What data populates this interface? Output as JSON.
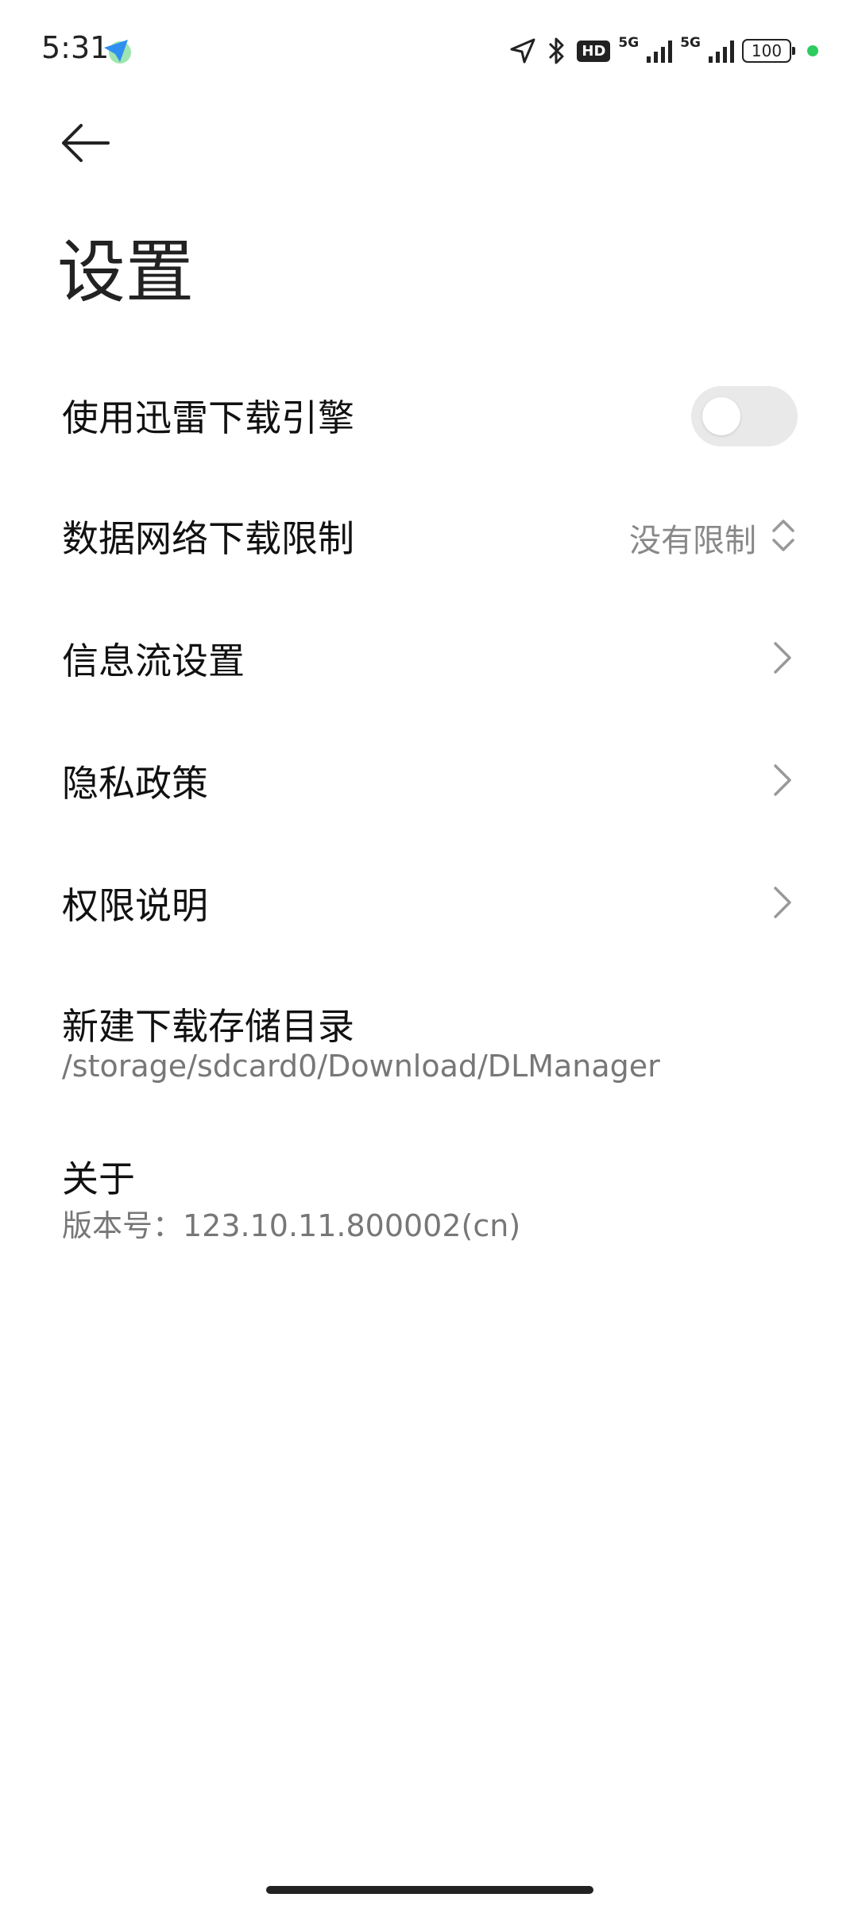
{
  "status_bar": {
    "time": "5:31",
    "hd_label": "HD",
    "network1": "5G",
    "network2": "5G",
    "battery": "100"
  },
  "header": {
    "title": "设置"
  },
  "settings": {
    "thunder_engine": {
      "label": "使用迅雷下载引擎",
      "enabled": false
    },
    "data_limit": {
      "label": "数据网络下载限制",
      "value": "没有限制"
    },
    "feed": {
      "label": "信息流设置"
    },
    "privacy": {
      "label": "隐私政策"
    },
    "permissions": {
      "label": "权限说明"
    },
    "storage": {
      "label": "新建下载存储目录",
      "path": "/storage/sdcard0/Download/DLManager"
    },
    "about": {
      "label": "关于",
      "version": "版本号：123.10.11.800002(cn)"
    }
  },
  "icons": {
    "back": "arrow-left-icon",
    "chevron": "chevron-right-icon",
    "updown": "chevron-up-down-icon",
    "location": "location-icon",
    "bluetooth": "bluetooth-icon"
  },
  "colors": {
    "accent_dot": "#2ecc5f",
    "toggle_off": "#e9e9e9",
    "secondary_text": "#888888"
  }
}
